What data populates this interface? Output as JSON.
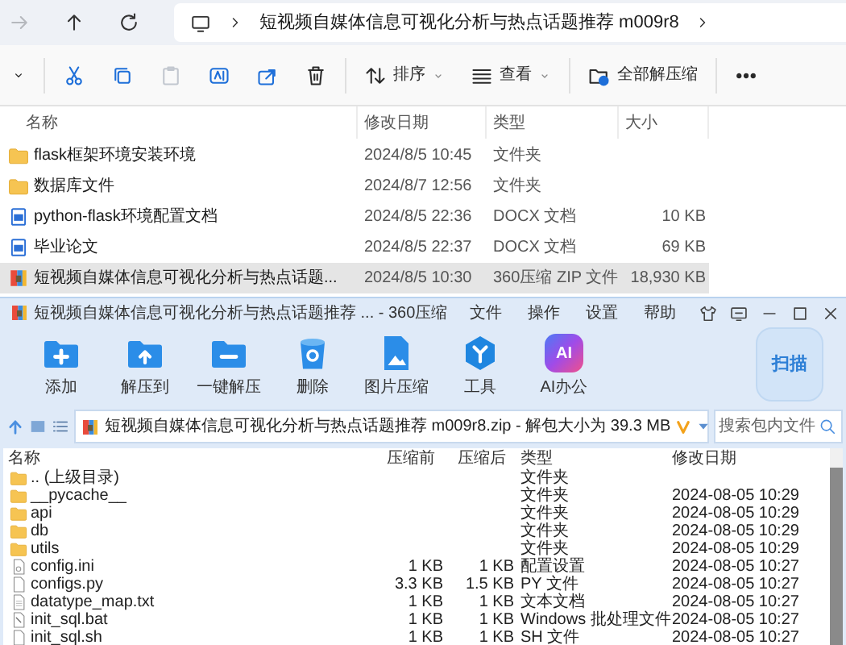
{
  "explorer": {
    "nav_buttons": [
      {
        "kind": "forward",
        "disabled": true
      },
      {
        "kind": "up",
        "disabled": false
      },
      {
        "kind": "refresh",
        "disabled": false
      }
    ],
    "address": {
      "path": "短视频自媒体信息可视化分析与热点话题推荐 m009r8"
    },
    "toolbar": [
      {
        "kind": "caret",
        "disabled": false
      },
      {
        "kind": "cut",
        "disabled": false
      },
      {
        "kind": "copy",
        "disabled": false
      },
      {
        "kind": "paste",
        "disabled": true
      },
      {
        "kind": "rename",
        "disabled": false
      },
      {
        "kind": "share",
        "disabled": false
      },
      {
        "kind": "delete",
        "disabled": false
      },
      {
        "kind": "sort",
        "label": "排序",
        "disabled": false
      },
      {
        "kind": "view",
        "label": "查看",
        "disabled": false
      },
      {
        "kind": "extract",
        "label": "全部解压缩",
        "disabled": false
      },
      {
        "kind": "more",
        "disabled": false
      }
    ],
    "columns": [
      "名称",
      "修改日期",
      "类型",
      "大小"
    ],
    "files": [
      {
        "kind": "folder",
        "name": "flask框架环境安装环境",
        "date": "2024/8/5 10:45",
        "type": "文件夹",
        "selected": false
      },
      {
        "kind": "folder",
        "name": "数据库文件",
        "date": "2024/8/7 12:56",
        "type": "文件夹",
        "selected": false
      },
      {
        "kind": "docx",
        "name": "python-flask环境配置文档",
        "date": "2024/8/5 22:36",
        "type": "DOCX 文档",
        "size": "10 KB",
        "selected": false
      },
      {
        "kind": "docx",
        "name": "毕业论文",
        "date": "2024/8/5 22:37",
        "type": "DOCX 文档",
        "size": "69 KB",
        "selected": false
      },
      {
        "kind": "zip",
        "name": "短视频自媒体信息可视化分析与热点话题...",
        "date": "2024/8/5 10:30",
        "type": "360压缩 ZIP 文件",
        "size": "18,930 KB",
        "selected": true
      }
    ]
  },
  "archiver": {
    "title": "短视频自媒体信息可视化分析与热点话题推荐 ... - 360压缩",
    "menus": [
      "文件",
      "操作",
      "设置",
      "帮助"
    ],
    "window_buttons": [
      {
        "kind": "skin"
      },
      {
        "kind": "feedback"
      },
      {
        "kind": "minimize"
      },
      {
        "kind": "maximize"
      },
      {
        "kind": "close"
      }
    ],
    "tools": [
      {
        "kind": "add",
        "label": "添加"
      },
      {
        "kind": "extract_to",
        "label": "解压到"
      },
      {
        "kind": "quick_extract",
        "label": "一键解压"
      },
      {
        "kind": "delete",
        "label": "删除"
      },
      {
        "kind": "image",
        "label": "图片压缩"
      },
      {
        "kind": "tools",
        "label": "工具"
      },
      {
        "kind": "ai",
        "label": "AI办公",
        "badge": "AI"
      }
    ],
    "scan_label": "扫描",
    "path": "短视频自媒体信息可视化分析与热点话题推荐 m009r8.zip - 解包大小为 39.3 MB",
    "search": {
      "placeholder": "搜索包内文件"
    },
    "columns": [
      "名称",
      "压缩前",
      "压缩后",
      "类型",
      "修改日期"
    ],
    "entries": [
      {
        "kind": "folder",
        "name": ".. (上级目录)",
        "type": "文件夹"
      },
      {
        "kind": "folder",
        "name": "__pycache__",
        "type": "文件夹",
        "date": "2024-08-05 10:29"
      },
      {
        "kind": "folder",
        "name": "api",
        "type": "文件夹",
        "date": "2024-08-05 10:29"
      },
      {
        "kind": "folder",
        "name": "db",
        "type": "文件夹",
        "date": "2024-08-05 10:29"
      },
      {
        "kind": "folder",
        "name": "utils",
        "type": "文件夹",
        "date": "2024-08-05 10:29"
      },
      {
        "kind": "settings",
        "name": "config.ini",
        "before": "1 KB",
        "after": "1 KB",
        "type": "配置设置",
        "date": "2024-08-05 10:27"
      },
      {
        "kind": "file",
        "name": "configs.py",
        "before": "3.3 KB",
        "after": "1.5 KB",
        "type": "PY 文件",
        "date": "2024-08-05 10:27"
      },
      {
        "kind": "text",
        "name": "datatype_map.txt",
        "before": "1 KB",
        "after": "1 KB",
        "type": "文本文档",
        "date": "2024-08-05 10:27"
      },
      {
        "kind": "batch",
        "name": "init_sql.bat",
        "before": "1 KB",
        "after": "1 KB",
        "type": "Windows 批处理文件",
        "date": "2024-08-05 10:27"
      },
      {
        "kind": "file",
        "name": "init_sql.sh",
        "before": "1 KB",
        "after": "1 KB",
        "type": "SH 文件",
        "date": "2024-08-05 10:27"
      }
    ]
  }
}
